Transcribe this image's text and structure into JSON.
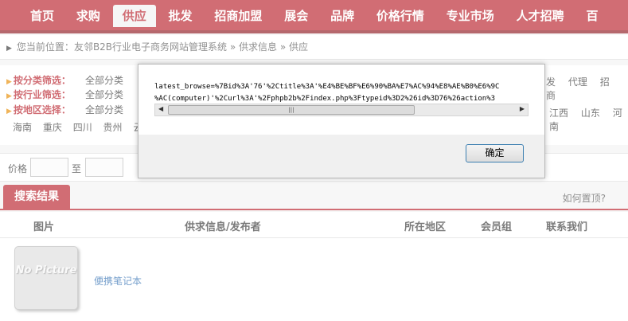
{
  "nav": {
    "items": [
      "首页",
      "求购",
      "供应",
      "批发",
      "招商加盟",
      "展会",
      "品牌",
      "价格行情",
      "专业市场",
      "人才招聘",
      "百"
    ],
    "active_index": 2
  },
  "breadcrumb": {
    "prefix": "您当前位置：",
    "path": "友邻B2B行业电子商务网站管理系统 » 供求信息 » 供应"
  },
  "filters": {
    "category": {
      "label": "按分类筛选：",
      "value": "全部分类"
    },
    "industry": {
      "label": "按行业筛选：",
      "value": "全部分类"
    },
    "region": {
      "label": "按地区选择：",
      "value": "全部分类"
    },
    "category_tail": [
      "发",
      "代理",
      "招商"
    ],
    "region_tail": [
      "江西",
      "山东",
      "河南"
    ],
    "areas": [
      "海南",
      "重庆",
      "四川",
      "贵州",
      "云"
    ]
  },
  "price": {
    "label": "价格",
    "to": "至"
  },
  "results": {
    "tab": "搜索结果",
    "how_to_top": "如何置顶?",
    "columns": [
      "图片",
      "供求信息/发布者",
      "所在地区",
      "会员组",
      "联系我们"
    ],
    "rows": [
      {
        "image_text": "No Picture",
        "title": "便携笔记本"
      }
    ]
  },
  "dialog": {
    "line1": "latest_browse=%7Bid%3A'76'%2Ctitle%3A'%E4%BE%BF%E6%90%BA%E7%AC%94%E8%AE%B0%E6%9C",
    "line2": "%AC(computer)'%2Curl%3A'%2Fphpb2b%2Findex.php%3Ftypeid%3D2%26id%3D76%26action%3",
    "scroll_grip": "|||",
    "ok": "确定"
  }
}
